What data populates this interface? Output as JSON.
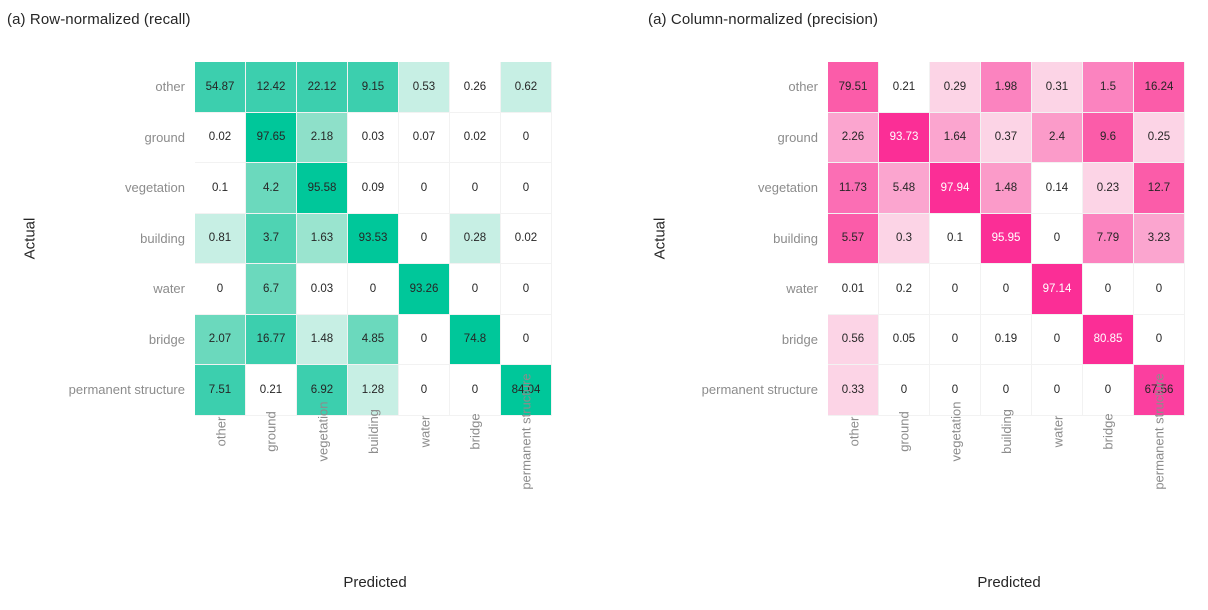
{
  "figure": {
    "background": "#ffffff",
    "panels": [
      {
        "title": "(a) Row-normalized (recall)",
        "xlabel": "Predicted",
        "ylabel": "Actual"
      },
      {
        "title": "(a) Column-normalized (precision)",
        "xlabel": "Predicted",
        "ylabel": "Actual"
      }
    ]
  },
  "chart_data": [
    {
      "type": "heatmap",
      "title": "(a) Row-normalized (recall)",
      "xlabel": "Predicted",
      "ylabel": "Actual",
      "normalization": "row",
      "units": "percent",
      "grid": true,
      "legend": "none",
      "colormap": "white-to-teal",
      "colors": {
        "low": "#ffffff",
        "high": "#00c79a"
      },
      "zlim": [
        0,
        100
      ],
      "x_categories": [
        "other",
        "ground",
        "vegetation",
        "building",
        "water",
        "bridge",
        "permanent structure"
      ],
      "y_categories": [
        "other",
        "ground",
        "vegetation",
        "building",
        "water",
        "bridge",
        "permanent structure"
      ],
      "rows": [
        {
          "label": "other",
          "values": [
            54.87,
            12.42,
            22.12,
            9.15,
            0.53,
            0.26,
            0.62
          ]
        },
        {
          "label": "ground",
          "values": [
            0.02,
            97.65,
            2.18,
            0.03,
            0.07,
            0.02,
            0
          ]
        },
        {
          "label": "vegetation",
          "values": [
            0.1,
            4.2,
            95.58,
            0.09,
            0,
            0,
            0
          ]
        },
        {
          "label": "building",
          "values": [
            0.81,
            3.7,
            1.63,
            93.53,
            0,
            0.28,
            0.02
          ]
        },
        {
          "label": "water",
          "values": [
            0,
            6.7,
            0.03,
            0,
            93.26,
            0,
            0
          ]
        },
        {
          "label": "bridge",
          "values": [
            2.07,
            16.77,
            1.48,
            4.85,
            0,
            74.8,
            0
          ]
        },
        {
          "label": "permanent structure",
          "values": [
            7.51,
            0.21,
            6.92,
            1.28,
            0,
            0,
            84.04
          ]
        }
      ],
      "cell_text": [
        [
          "54.87",
          "12.42",
          "22.12",
          "9.15",
          "0.53",
          "0.26",
          "0.62"
        ],
        [
          "0.02",
          "97.65",
          "2.18",
          "0.03",
          "0.07",
          "0.02",
          "0"
        ],
        [
          "0.1",
          "4.2",
          "95.58",
          "0.09",
          "0",
          "0",
          "0"
        ],
        [
          "0.81",
          "3.7",
          "1.63",
          "93.53",
          "0",
          "0.28",
          "0.02"
        ],
        [
          "0",
          "6.7",
          "0.03",
          "0",
          "93.26",
          "0",
          "0"
        ],
        [
          "2.07",
          "16.77",
          "1.48",
          "4.85",
          "0",
          "74.8",
          "0"
        ],
        [
          "7.51",
          "0.21",
          "6.92",
          "1.28",
          "0",
          "0",
          "84.04"
        ]
      ],
      "cell_fills": [
        [
          "#3ccfae",
          "#3ccfae",
          "#3ccfae",
          "#3ccfae",
          "#c7efe4",
          "#ffffff",
          "#c7efe4"
        ],
        [
          "#ffffff",
          "#00c79a",
          "#8ee0c9",
          "#ffffff",
          "#ffffff",
          "#ffffff",
          "#ffffff"
        ],
        [
          "#ffffff",
          "#6bd9bd",
          "#00c79a",
          "#ffffff",
          "#ffffff",
          "#ffffff",
          "#ffffff"
        ],
        [
          "#c7efe4",
          "#4fd3b3",
          "#9ae4cf",
          "#00c79a",
          "#ffffff",
          "#c7efe4",
          "#ffffff"
        ],
        [
          "#ffffff",
          "#6bd9bd",
          "#ffffff",
          "#ffffff",
          "#00c79a",
          "#ffffff",
          "#ffffff"
        ],
        [
          "#6bd9bd",
          "#3ccfae",
          "#c7efe4",
          "#6bd9bd",
          "#ffffff",
          "#00c79a",
          "#ffffff"
        ],
        [
          "#3ccfae",
          "#ffffff",
          "#3ccfae",
          "#c7efe4",
          "#ffffff",
          "#ffffff",
          "#00c79a"
        ]
      ],
      "cell_text_light": [
        [
          false,
          false,
          false,
          false,
          false,
          false,
          false
        ],
        [
          false,
          false,
          false,
          false,
          false,
          false,
          false
        ],
        [
          false,
          false,
          false,
          false,
          false,
          false,
          false
        ],
        [
          false,
          false,
          false,
          false,
          false,
          false,
          false
        ],
        [
          false,
          false,
          false,
          false,
          false,
          false,
          false
        ],
        [
          false,
          false,
          false,
          false,
          false,
          false,
          false
        ],
        [
          false,
          false,
          false,
          false,
          false,
          false,
          false
        ]
      ]
    },
    {
      "type": "heatmap",
      "title": "(a) Column-normalized (precision)",
      "xlabel": "Predicted",
      "ylabel": "Actual",
      "normalization": "column",
      "units": "percent",
      "grid": true,
      "legend": "none",
      "colormap": "white-to-pink",
      "colors": {
        "low": "#ffffff",
        "high": "#fb2e96"
      },
      "zlim": [
        0,
        100
      ],
      "x_categories": [
        "other",
        "ground",
        "vegetation",
        "building",
        "water",
        "bridge",
        "permanent structure"
      ],
      "y_categories": [
        "other",
        "ground",
        "vegetation",
        "building",
        "water",
        "bridge",
        "permanent structure"
      ],
      "rows": [
        {
          "label": "other",
          "values": [
            79.51,
            0.21,
            0.29,
            1.98,
            0.31,
            1.5,
            16.24
          ]
        },
        {
          "label": "ground",
          "values": [
            2.26,
            93.73,
            1.64,
            0.37,
            2.4,
            9.6,
            0.25
          ]
        },
        {
          "label": "vegetation",
          "values": [
            11.73,
            5.48,
            97.94,
            1.48,
            0.14,
            0.23,
            12.7
          ]
        },
        {
          "label": "building",
          "values": [
            5.57,
            0.3,
            0.1,
            95.95,
            0,
            7.79,
            3.23
          ]
        },
        {
          "label": "water",
          "values": [
            0.01,
            0.2,
            0,
            0,
            97.14,
            0,
            0
          ]
        },
        {
          "label": "bridge",
          "values": [
            0.56,
            0.05,
            0,
            0.19,
            0,
            80.85,
            0
          ]
        },
        {
          "label": "permanent structure",
          "values": [
            0.33,
            0,
            0,
            0,
            0,
            0,
            67.56
          ]
        }
      ],
      "cell_text": [
        [
          "79.51",
          "0.21",
          "0.29",
          "1.98",
          "0.31",
          "1.5",
          "16.24"
        ],
        [
          "2.26",
          "93.73",
          "1.64",
          "0.37",
          "2.4",
          "9.6",
          "0.25"
        ],
        [
          "11.73",
          "5.48",
          "97.94",
          "1.48",
          "0.14",
          "0.23",
          "12.7"
        ],
        [
          "5.57",
          "0.3",
          "0.1",
          "95.95",
          "0",
          "7.79",
          "3.23"
        ],
        [
          "0.01",
          "0.2",
          "0",
          "0",
          "97.14",
          "0",
          "0"
        ],
        [
          "0.56",
          "0.05",
          "0",
          "0.19",
          "0",
          "80.85",
          "0"
        ],
        [
          "0.33",
          "0",
          "0",
          "0",
          "0",
          "0",
          "67.56"
        ]
      ],
      "cell_fills": [
        [
          "#fb5ca9",
          "#ffffff",
          "#fcd4e6",
          "#fb83bf",
          "#fcd4e6",
          "#fb83bf",
          "#fb5ca9"
        ],
        [
          "#fba5cf",
          "#fb2e96",
          "#fba5cf",
          "#fcd4e6",
          "#fb9bc9",
          "#fb5ca9",
          "#fcd4e6"
        ],
        [
          "#fb6eb4",
          "#fba5cf",
          "#fb2e96",
          "#fb9bc9",
          "#ffffff",
          "#fcd4e6",
          "#fb5ca9"
        ],
        [
          "#fb5ca9",
          "#fcd4e6",
          "#ffffff",
          "#fb2e96",
          "#ffffff",
          "#fb83bf",
          "#fba5cf"
        ],
        [
          "#ffffff",
          "#ffffff",
          "#ffffff",
          "#ffffff",
          "#fb2e96",
          "#ffffff",
          "#ffffff"
        ],
        [
          "#fcd4e6",
          "#ffffff",
          "#ffffff",
          "#ffffff",
          "#ffffff",
          "#fb2e96",
          "#ffffff"
        ],
        [
          "#fcd4e6",
          "#ffffff",
          "#ffffff",
          "#ffffff",
          "#ffffff",
          "#ffffff",
          "#fb3f9f"
        ]
      ],
      "cell_text_light": [
        [
          false,
          false,
          false,
          false,
          false,
          false,
          false
        ],
        [
          false,
          true,
          false,
          false,
          false,
          false,
          false
        ],
        [
          false,
          false,
          true,
          false,
          false,
          false,
          false
        ],
        [
          false,
          false,
          false,
          true,
          false,
          false,
          false
        ],
        [
          false,
          false,
          false,
          false,
          true,
          false,
          false
        ],
        [
          false,
          false,
          false,
          false,
          false,
          true,
          false
        ],
        [
          false,
          false,
          false,
          false,
          false,
          false,
          false
        ]
      ]
    }
  ]
}
